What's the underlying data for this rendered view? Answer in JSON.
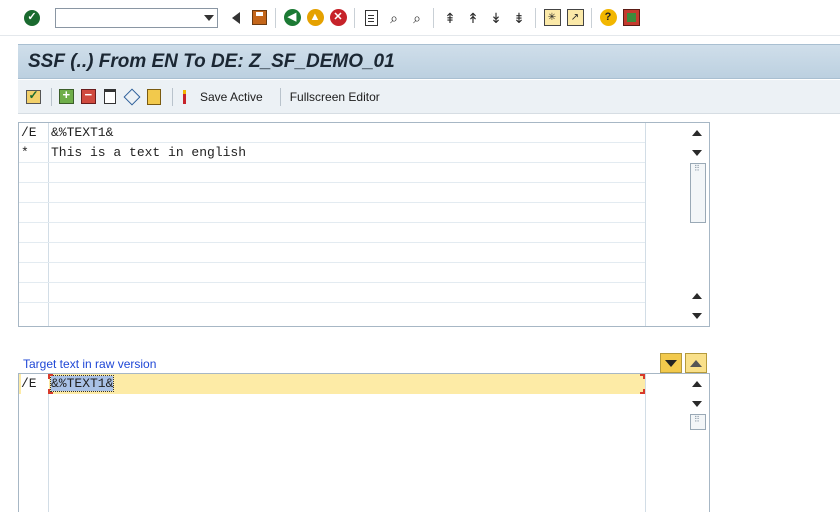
{
  "system_toolbar": {
    "command_field": {
      "value": "",
      "placeholder": ""
    },
    "icons": [
      "enter-icon",
      "back-icon",
      "save-icon",
      "back-nav-icon",
      "exit-icon",
      "cancel-icon",
      "print-icon",
      "find-icon",
      "find-next-icon",
      "first-page-icon",
      "previous-page-icon",
      "next-page-icon",
      "last-page-icon",
      "new-session-icon",
      "shortcut-icon",
      "help-icon",
      "customize-layout-icon"
    ]
  },
  "title": "SSF (..) From EN To DE: Z_SF_DEMO_01",
  "app_toolbar": {
    "save_active_label": "Save Active",
    "fullscreen_editor_label": "Fullscreen Editor"
  },
  "source_editor": {
    "rows": [
      {
        "tag": "/E",
        "text": "&%TEXT1&"
      },
      {
        "tag": "*",
        "text": "This is a text in english"
      }
    ]
  },
  "target_editor": {
    "label": "Target text in raw version",
    "rows": [
      {
        "tag": "/E",
        "text": "&%TEXT1&"
      }
    ]
  },
  "colors": {
    "title_bar": "#c6d8e7",
    "link_blue": "#1f47d6",
    "highlight": "#fdeba6"
  }
}
